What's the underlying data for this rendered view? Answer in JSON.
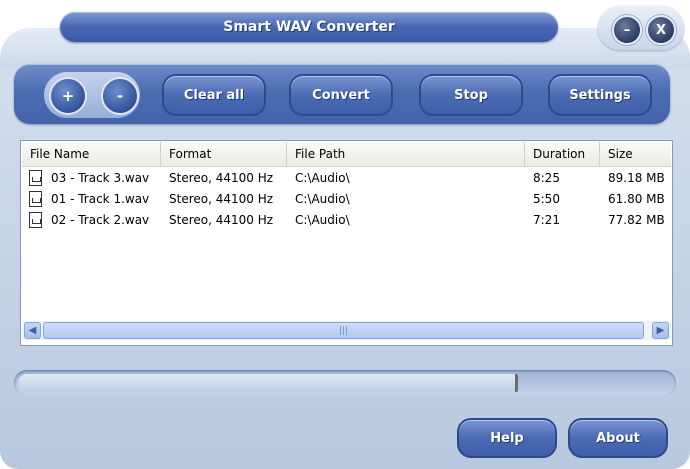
{
  "window": {
    "title": "Smart WAV Converter",
    "minimize_label": "–",
    "close_label": "X"
  },
  "toolbar": {
    "add_label": "+",
    "remove_label": "-",
    "clear_all_label": "Clear all",
    "convert_label": "Convert",
    "stop_label": "Stop",
    "settings_label": "Settings"
  },
  "file_list": {
    "columns": [
      "File Name",
      "Format",
      "File Path",
      "Duration",
      "Size"
    ],
    "rows": [
      {
        "name": "03 - Track  3.wav",
        "format": "Stereo, 44100 Hz",
        "path": "C:\\Audio\\",
        "duration": "8:25",
        "size": "89.18 MB"
      },
      {
        "name": "01 - Track  1.wav",
        "format": "Stereo, 44100 Hz",
        "path": "C:\\Audio\\",
        "duration": "5:50",
        "size": "61.80 MB"
      },
      {
        "name": "02 - Track  2.wav",
        "format": "Stereo, 44100 Hz",
        "path": "C:\\Audio\\",
        "duration": "7:21",
        "size": "77.82 MB"
      }
    ],
    "scroll_left": "◀",
    "scroll_right": "▶",
    "scroll_grip": "|||"
  },
  "progress": {
    "fraction": 0.76
  },
  "footer": {
    "help_label": "Help",
    "about_label": "About"
  },
  "colors": {
    "accent": "#4868b4",
    "frame": "#c4d2e6"
  }
}
